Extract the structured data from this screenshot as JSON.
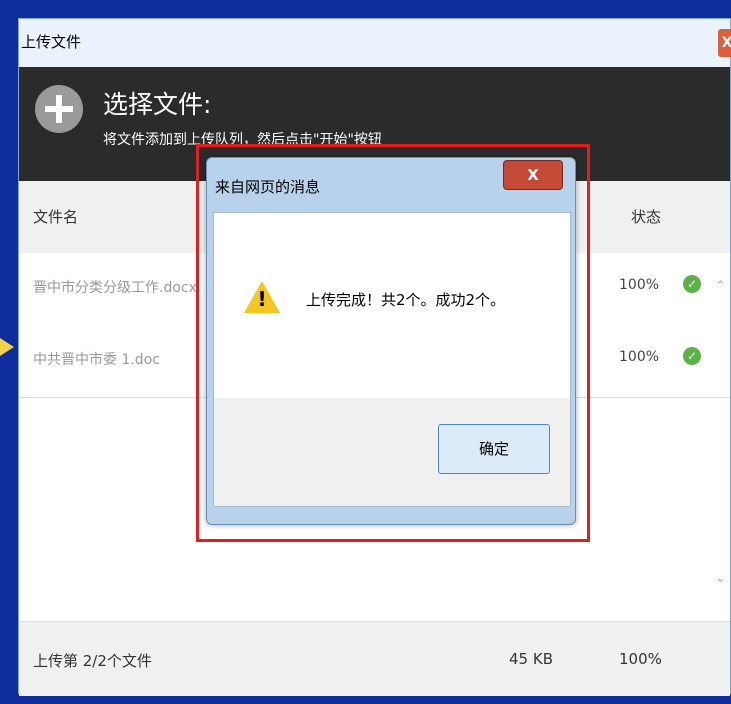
{
  "window": {
    "title": "上传文件",
    "close_label": "X"
  },
  "banner": {
    "heading": "选择文件:",
    "subtitle": "将文件添加到上传队列，然后点击\"开始\"按钮"
  },
  "columns": {
    "filename": "文件名",
    "status": "状态"
  },
  "files": [
    {
      "name": "晋中市分类分级工作.docx",
      "progress": "100%"
    },
    {
      "name": "中共晋中市委 1.doc",
      "progress": "100%"
    }
  ],
  "footer": {
    "summary": "上传第 2/2个文件",
    "size": "45 KB",
    "progress": "100%"
  },
  "dialog": {
    "title": "来自网页的消息",
    "close_label": "X",
    "message": "上传完成！共2个。成功2个。",
    "ok_label": "确定"
  },
  "icons": {
    "plus": "plus-icon",
    "check": "check-icon",
    "warning": "warning-icon",
    "scroll_up": "chevron-up-icon",
    "scroll_down": "chevron-down-icon",
    "pointer": "arrow-right-icon"
  },
  "colors": {
    "background": "#0f2e9c",
    "success": "#5cb14a",
    "warning": "#f3c623",
    "highlight": "#e02020"
  }
}
